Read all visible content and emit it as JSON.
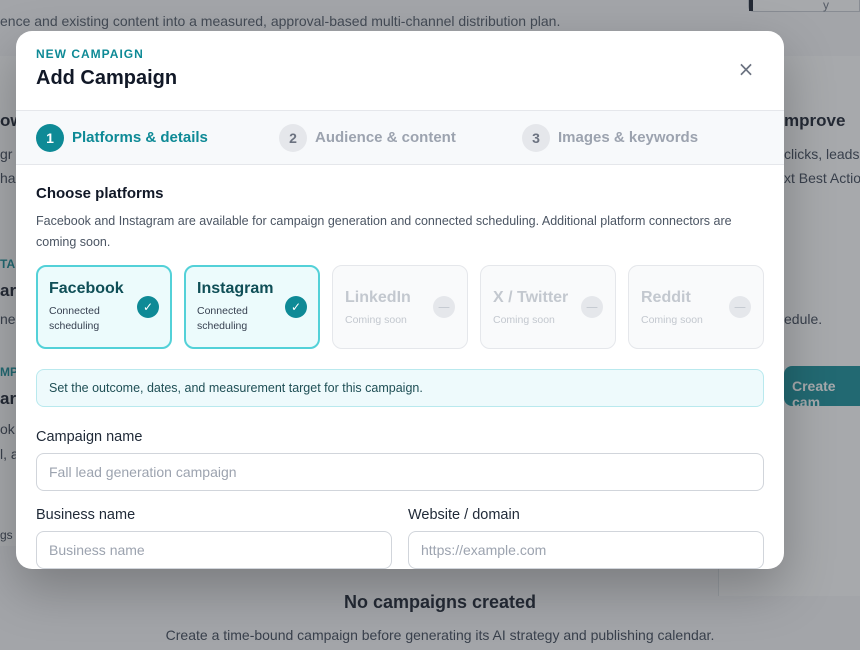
{
  "background": {
    "intro_text": "ence and existing content into a measured, approval-based multi-channel distribution plan.",
    "topright_text": "y",
    "left_fragments": [
      "ow",
      "gr",
      "ha",
      "TA",
      "ar",
      "ne",
      "MP",
      "ar",
      "ok",
      "l, a",
      "gs"
    ],
    "right_heading": "mprove",
    "right_lines": [
      "clicks, leads",
      "xt Best Actio",
      "edule."
    ],
    "create_button": "Create cam",
    "empty_title": "No campaigns created",
    "empty_subtitle": "Create a time-bound campaign before generating its AI strategy and publishing calendar."
  },
  "modal": {
    "eyebrow": "NEW CAMPAIGN",
    "title": "Add Campaign",
    "close_glyph": "×",
    "steps": [
      {
        "num": "1",
        "label": "Platforms & details",
        "active": true
      },
      {
        "num": "2",
        "label": "Audience & content",
        "active": false
      },
      {
        "num": "3",
        "label": "Images & keywords",
        "active": false
      }
    ],
    "platforms_title": "Choose platforms",
    "platforms_desc": "Facebook and Instagram are available for campaign generation and connected scheduling. Additional platform connectors are coming soon.",
    "platforms": [
      {
        "name": "Facebook",
        "status": "Connected scheduling",
        "icon": "check-icon",
        "glyph": "✓"
      },
      {
        "name": "Instagram",
        "status": "Connected scheduling",
        "icon": "check-icon",
        "glyph": "✓"
      },
      {
        "name": "LinkedIn",
        "status": "Coming soon",
        "icon": "minus-icon",
        "glyph": "—"
      },
      {
        "name": "X / Twitter",
        "status": "Coming soon",
        "icon": "minus-icon",
        "glyph": "—"
      },
      {
        "name": "Reddit",
        "status": "Coming soon",
        "icon": "minus-icon",
        "glyph": "—"
      }
    ],
    "info_note": "Set the outcome, dates, and measurement target for this campaign.",
    "campaign_name": {
      "label": "Campaign name",
      "placeholder": "Fall lead generation campaign",
      "value": ""
    },
    "business_name": {
      "label": "Business name",
      "placeholder": "Business name",
      "value": ""
    },
    "website": {
      "label": "Website / domain",
      "placeholder": "https://example.com",
      "value": ""
    }
  },
  "colors": {
    "accent": "#0e8a96",
    "selected_border": "#53d1d8",
    "selected_bg": "#ecfbfc"
  }
}
